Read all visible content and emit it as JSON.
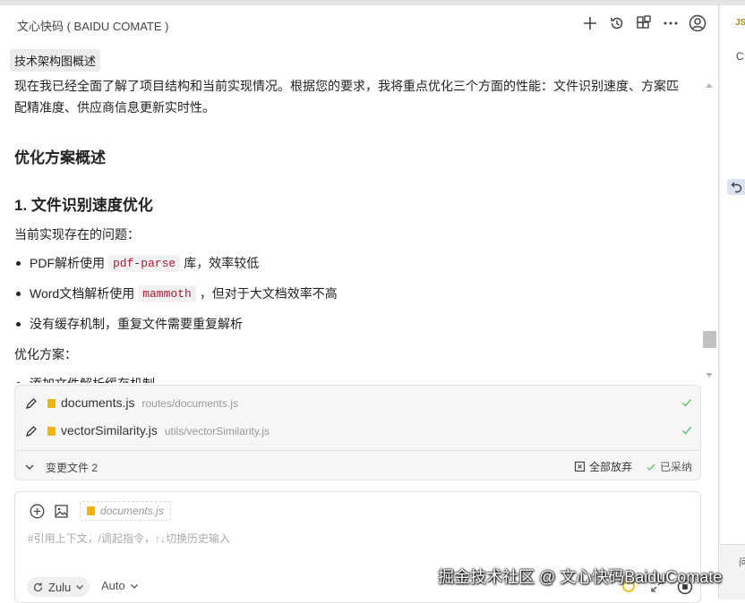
{
  "app": {
    "title": "文心快码 ( BAIDU COMATE )"
  },
  "chip": {
    "label": "技术架构图概述"
  },
  "right_panel": {
    "tab_label": "JS",
    "panel_initial": "C",
    "bottom_text": "问"
  },
  "content": {
    "intro": "现在我已经全面了解了项目结构和当前实现情况。根据您的要求，我将重点优化三个方面的性能：文件识别速度、方案匹配精准度、供应商信息更新实时性。",
    "section_title": "优化方案概述",
    "subsection_title": "1. 文件识别速度优化",
    "problems_label": "当前实现存在的问题：",
    "bullets": [
      {
        "before": "PDF解析使用",
        "code": "pdf-parse",
        "after": "库，效率较低"
      },
      {
        "before": "Word文档解析使用",
        "code": "mammoth",
        "after": "，但对于大文档效率不高"
      },
      {
        "text": "没有缓存机制，重复文件需要重复解析"
      }
    ],
    "solution_label": "优化方案：",
    "partial_bullet": "添加文件解析缓存机制"
  },
  "changes": {
    "files": [
      {
        "name": "documents.js",
        "path": "routes/documents.js"
      },
      {
        "name": "vectorSimilarity.js",
        "path": "utils/vectorSimilarity.js"
      }
    ],
    "summary": "变更文件 2",
    "discard_label": "全部放弃",
    "accepted_label": "已采纳"
  },
  "input": {
    "attached_file": "documents.js",
    "placeholder": "#引用上下文，/调起指令，↑↓切换历史输入"
  },
  "footer": {
    "model": "Zulu",
    "mode": "Auto"
  },
  "watermark": "掘金技术社区 @ 文心快码BaiduComate",
  "colors": {
    "accent_js": "#f0b40b",
    "code_text": "#b3152c",
    "check_green": "#5cb85c"
  }
}
